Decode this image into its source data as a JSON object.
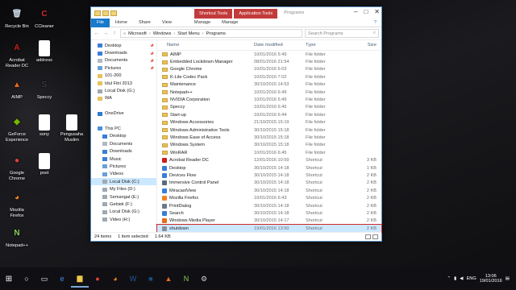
{
  "desktop": {
    "icons": [
      {
        "label": "Recycle Bin",
        "glyph": "🗑",
        "color": "#c8d4e4"
      },
      {
        "label": "CCleaner",
        "glyph": "C",
        "color": "#d62a2a"
      },
      {
        "label": "Acrobat Reader DC",
        "glyph": "A",
        "color": "#cc1e1e"
      },
      {
        "label": "address",
        "glyph": "",
        "color": "#ffffff"
      },
      {
        "label": "AIMP",
        "glyph": "▲",
        "color": "#e86b1a"
      },
      {
        "label": "Speccy",
        "glyph": "S",
        "color": "#3a3a3a"
      },
      {
        "label": "GeForce Experience",
        "glyph": "◆",
        "color": "#76b900"
      },
      {
        "label": "sony",
        "glyph": "",
        "color": "#ffffff"
      },
      {
        "label": "Pengusaha Muslim",
        "glyph": "",
        "color": "#ffffff"
      },
      {
        "label": "Google Chrome",
        "glyph": "●",
        "color": "#e34133"
      },
      {
        "label": "post",
        "glyph": "",
        "color": "#ffffff"
      },
      {
        "label": "Mozilla Firefox",
        "glyph": "◕",
        "color": "#f58220"
      },
      {
        "label": "Notepad++",
        "glyph": "N",
        "color": "#8ccf5a"
      }
    ]
  },
  "window": {
    "title": "Programs",
    "context_tabs": [
      "Shortcut Tools",
      "Application Tools"
    ],
    "ribbon_tabs": [
      "File",
      "Home",
      "Share",
      "View",
      "Manage",
      "Manage"
    ],
    "address": [
      "Microsoft",
      "Windows",
      "Start Menu",
      "Programs"
    ],
    "search_placeholder": "Search Programs",
    "columns": [
      "Name",
      "Date modified",
      "Type",
      "Size"
    ],
    "nav": [
      {
        "label": "Desktop",
        "pin": "✈",
        "ic": "#3b7dd8"
      },
      {
        "label": "Downloads",
        "pin": "✈",
        "ic": "#3b7dd8"
      },
      {
        "label": "Documents",
        "pin": "✈",
        "ic": "#b0bac6"
      },
      {
        "label": "Pictures",
        "pin": "✈",
        "ic": "#6aa0d6"
      },
      {
        "label": "101-200",
        "pin": "",
        "ic": "#e8c25c"
      },
      {
        "label": "Idul Fitri 2013",
        "pin": "",
        "ic": "#e8c25c"
      },
      {
        "label": "Local Disk (G:)",
        "pin": "",
        "ic": "#a0a8b0"
      },
      {
        "label": "WA",
        "pin": "",
        "ic": "#e8c25c"
      },
      {
        "label": "",
        "pin": "",
        "ic": "transparent"
      },
      {
        "label": "OneDrive",
        "pin": "",
        "ic": "#2b7ad1"
      },
      {
        "label": "",
        "pin": "",
        "ic": "transparent"
      },
      {
        "label": "This PC",
        "pin": "",
        "ic": "#4a90d9"
      },
      {
        "label": "Desktop",
        "pin": "",
        "ic": "#3b7dd8"
      },
      {
        "label": "Documents",
        "pin": "",
        "ic": "#b0bac6"
      },
      {
        "label": "Downloads",
        "pin": "",
        "ic": "#3b7dd8"
      },
      {
        "label": "Music",
        "pin": "",
        "ic": "#3b7dd8"
      },
      {
        "label": "Pictures",
        "pin": "",
        "ic": "#6aa0d6"
      },
      {
        "label": "Videos",
        "pin": "",
        "ic": "#6aa0d6"
      },
      {
        "label": "Local Disk (C:)",
        "pin": "",
        "ic": "#a0a8b0",
        "sel": true
      },
      {
        "label": "My Files (D:)",
        "pin": "",
        "ic": "#a0a8b0"
      },
      {
        "label": "Semangat (E:)",
        "pin": "",
        "ic": "#a0a8b0"
      },
      {
        "label": "Gebiek (F:)",
        "pin": "",
        "ic": "#a0a8b0"
      },
      {
        "label": "Local Disk (G:)",
        "pin": "",
        "ic": "#a0a8b0"
      },
      {
        "label": "Video (H:)",
        "pin": "",
        "ic": "#a0a8b0"
      },
      {
        "label": "",
        "pin": "",
        "ic": "transparent"
      },
      {
        "label": "Network",
        "pin": "",
        "ic": "#4a90d9"
      }
    ],
    "rows": [
      {
        "name": "AIMP",
        "date": "10/01/2016 5:49",
        "type": "File folder",
        "size": "",
        "kind": "folder"
      },
      {
        "name": "Embedded Lockdown Manager",
        "date": "08/01/2016 21:54",
        "type": "File folder",
        "size": "",
        "kind": "folder"
      },
      {
        "name": "Google Chrome",
        "date": "10/01/2016 6:03",
        "type": "File folder",
        "size": "",
        "kind": "folder"
      },
      {
        "name": "K-Lite Codec Pack",
        "date": "10/01/2016 7:02",
        "type": "File folder",
        "size": "",
        "kind": "folder"
      },
      {
        "name": "Maintenance",
        "date": "30/10/2015 14:53",
        "type": "File folder",
        "size": "",
        "kind": "folder"
      },
      {
        "name": "Notepad++",
        "date": "10/01/2016 6:49",
        "type": "File folder",
        "size": "",
        "kind": "folder"
      },
      {
        "name": "NVIDIA Corporation",
        "date": "10/01/2016 5:49",
        "type": "File folder",
        "size": "",
        "kind": "folder"
      },
      {
        "name": "Speccy",
        "date": "10/01/2016 6:45",
        "type": "File folder",
        "size": "",
        "kind": "folder"
      },
      {
        "name": "Start-up",
        "date": "10/01/2016 6:44",
        "type": "File folder",
        "size": "",
        "kind": "folder"
      },
      {
        "name": "Windows Accessories",
        "date": "21/10/2015 15:19",
        "type": "File folder",
        "size": "",
        "kind": "folder"
      },
      {
        "name": "Windows Administrative Tools",
        "date": "30/10/2015 15:18",
        "type": "File folder",
        "size": "",
        "kind": "folder"
      },
      {
        "name": "Windows Ease of Access",
        "date": "30/10/2015 15:18",
        "type": "File folder",
        "size": "",
        "kind": "folder"
      },
      {
        "name": "Windows System",
        "date": "30/10/2015 15:18",
        "type": "File folder",
        "size": "",
        "kind": "folder"
      },
      {
        "name": "WinRAR",
        "date": "10/01/2016 6:45",
        "type": "File folder",
        "size": "",
        "kind": "folder"
      },
      {
        "name": "Acrobat Reader DC",
        "date": "12/01/2016 10:59",
        "type": "Shortcut",
        "size": "3 KB",
        "kind": "app",
        "ic": "#cc1e1e"
      },
      {
        "name": "Desktop",
        "date": "30/10/2015 14:18",
        "type": "Shortcut",
        "size": "1 KB",
        "kind": "app",
        "ic": "#3b7dd8"
      },
      {
        "name": "Devices Flow",
        "date": "30/10/2015 14:18",
        "type": "Shortcut",
        "size": "2 KB",
        "kind": "app",
        "ic": "#3b7dd8"
      },
      {
        "name": "Immersive Control Panel",
        "date": "30/10/2015 14:18",
        "type": "Shortcut",
        "size": "2 KB",
        "kind": "app",
        "ic": "#5a6b80"
      },
      {
        "name": "MiracastView",
        "date": "30/10/2015 14:18",
        "type": "Shortcut",
        "size": "2 KB",
        "kind": "app",
        "ic": "#3b7dd8"
      },
      {
        "name": "Mozilla Firefox",
        "date": "10/01/2016 6:43",
        "type": "Shortcut",
        "size": "2 KB",
        "kind": "app",
        "ic": "#f58220"
      },
      {
        "name": "PrintDialog",
        "date": "30/10/2015 14:18",
        "type": "Shortcut",
        "size": "2 KB",
        "kind": "app",
        "ic": "#6d7a8a"
      },
      {
        "name": "Search",
        "date": "30/10/2015 14:18",
        "type": "Shortcut",
        "size": "2 KB",
        "kind": "app",
        "ic": "#3b7dd8"
      },
      {
        "name": "Windows Media Player",
        "date": "30/10/2015 14:17",
        "type": "Shortcut",
        "size": "2 KB",
        "kind": "app",
        "ic": "#e86b1a"
      },
      {
        "name": "shutdown",
        "date": "19/01/2016 13:50",
        "type": "Shortcut",
        "size": "2 KB",
        "kind": "app",
        "ic": "#8a8f96",
        "selected": true
      }
    ],
    "status": {
      "count": "24 items",
      "selection": "1 item selected",
      "size": "1.64 KB"
    }
  },
  "taskbar": {
    "time": "13:06",
    "date": "19/01/2016",
    "lang": "ENG",
    "icons": [
      {
        "glyph": "○",
        "name": "search-icon",
        "color": "#ffffff"
      },
      {
        "glyph": "▭",
        "name": "task-view-icon",
        "color": "#ffffff"
      },
      {
        "glyph": "e",
        "name": "edge-icon",
        "color": "#3b8ee6"
      },
      {
        "glyph": "▆",
        "name": "file-explorer-icon",
        "color": "#f1c94a",
        "active": true
      },
      {
        "glyph": "●",
        "name": "chrome-icon",
        "color": "#e34133"
      },
      {
        "glyph": "◕",
        "name": "firefox-icon",
        "color": "#f58220"
      },
      {
        "glyph": "W",
        "name": "word-icon",
        "color": "#2b5797"
      },
      {
        "glyph": "■",
        "name": "photoshop-icon",
        "color": "#1c4b7c"
      },
      {
        "glyph": "▲",
        "name": "aimp-icon",
        "color": "#e86b1a"
      },
      {
        "glyph": "N",
        "name": "notepadpp-icon",
        "color": "#8ccf5a"
      },
      {
        "glyph": "⚙",
        "name": "settings-icon",
        "color": "#cccccc"
      }
    ]
  }
}
